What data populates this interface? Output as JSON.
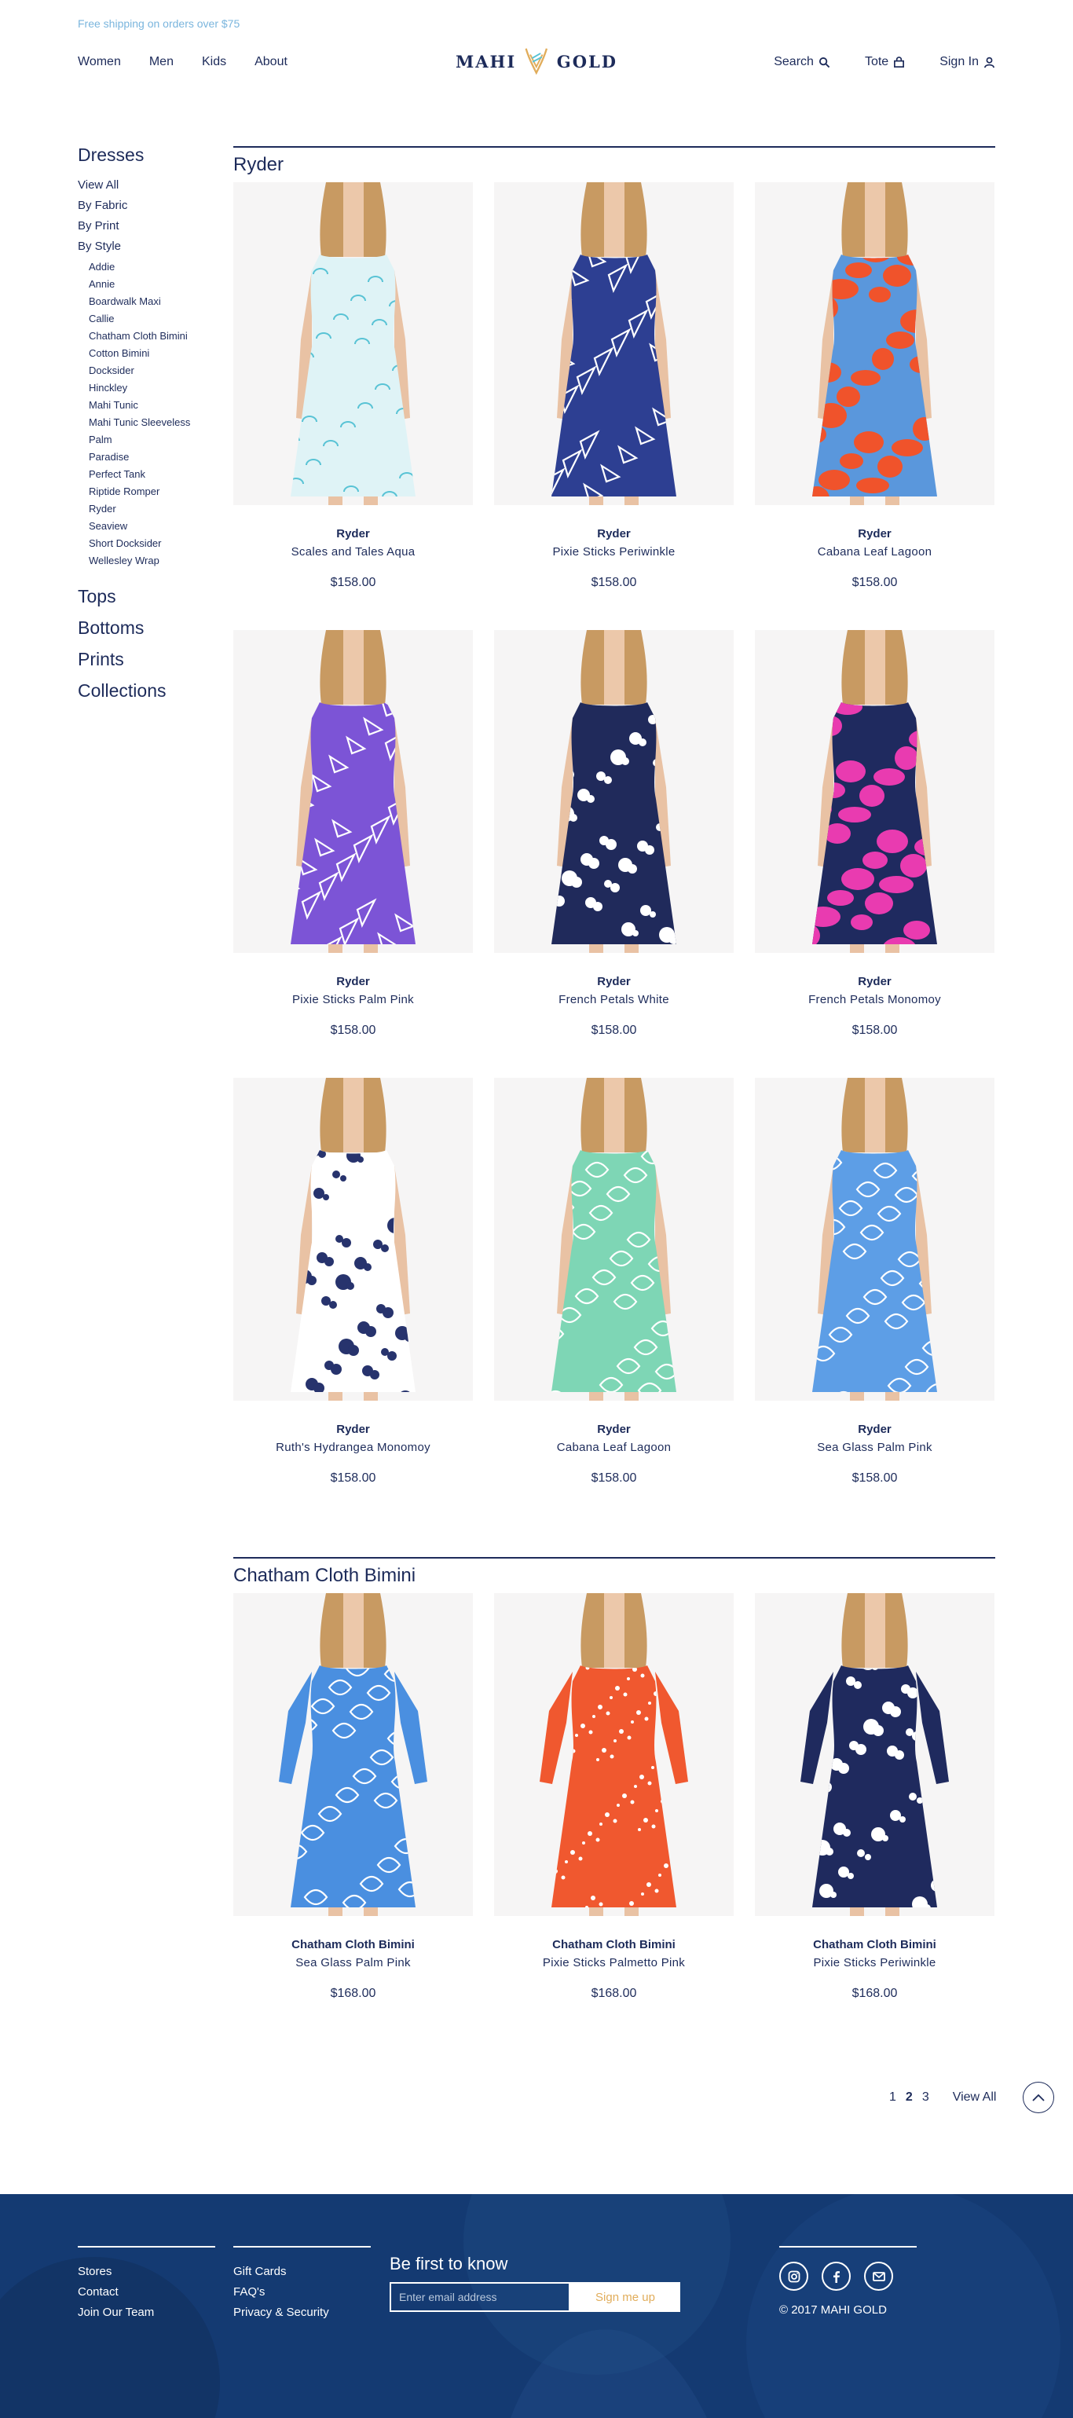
{
  "promo": "Free shipping on orders over $75",
  "nav": {
    "left": [
      "Women",
      "Men",
      "Kids",
      "About"
    ],
    "logo_left": "MAHI",
    "logo_right": "GOLD",
    "search": "Search",
    "tote": "Tote",
    "sign_in": "Sign In"
  },
  "sidebar": {
    "heading": "Dresses",
    "links": [
      "View All",
      "By Fabric",
      "By Print",
      "By Style"
    ],
    "styles": [
      "Addie",
      "Annie",
      "Boardwalk Maxi",
      "Callie",
      "Chatham Cloth Bimini",
      "Cotton Bimini",
      "Docksider",
      "Hinckley",
      "Mahi Tunic",
      "Mahi Tunic Sleeveless",
      "Palm",
      "Paradise",
      "Perfect Tank",
      "Riptide Romper",
      "Ryder",
      "Seaview",
      "Short Docksider",
      "Wellesley Wrap"
    ],
    "categories": [
      "Tops",
      "Bottoms",
      "Prints",
      "Collections"
    ]
  },
  "sections": [
    {
      "title": "Ryder",
      "products": [
        {
          "brand": "Ryder",
          "name": "Scales and Tales Aqua",
          "price": "$158.00",
          "dress": "#dff3f6",
          "print": "#59c3d5",
          "pattern": "scales",
          "sleeves": false
        },
        {
          "brand": "Ryder",
          "name": "Pixie Sticks Periwinkle",
          "price": "$158.00",
          "dress": "#2d3f92",
          "print": "#ffffff",
          "pattern": "sticks",
          "sleeves": false
        },
        {
          "brand": "Ryder",
          "name": "Cabana Leaf Lagoon",
          "price": "$158.00",
          "dress": "#5a97dc",
          "print": "#f0532b",
          "pattern": "blobs",
          "sleeves": false
        },
        {
          "brand": "Ryder",
          "name": "Pixie Sticks Palm Pink",
          "price": "$158.00",
          "dress": "#7c54d6",
          "print": "#ffffff",
          "pattern": "sticks",
          "sleeves": false
        },
        {
          "brand": "Ryder",
          "name": "French Petals White",
          "price": "$158.00",
          "dress": "#202a5b",
          "print": "#ffffff",
          "pattern": "petals",
          "sleeves": false
        },
        {
          "brand": "Ryder",
          "name": "French Petals Monomoy",
          "price": "$158.00",
          "dress": "#1f2a5f",
          "print": "#e93bb0",
          "pattern": "blobs",
          "sleeves": false
        },
        {
          "brand": "Ryder",
          "name": "Ruth's Hydrangea Monomoy",
          "price": "$158.00",
          "dress": "#ffffff",
          "print": "#27336d",
          "pattern": "petals",
          "sleeves": false
        },
        {
          "brand": "Ryder",
          "name": "Cabana Leaf Lagoon",
          "price": "$158.00",
          "dress": "#7ed6b5",
          "print": "#ffffff",
          "pattern": "leaves",
          "sleeves": false
        },
        {
          "brand": "Ryder",
          "name": "Sea Glass Palm Pink",
          "price": "$158.00",
          "dress": "#5d9ee6",
          "print": "#ffffff",
          "pattern": "leaves",
          "sleeves": false
        }
      ]
    },
    {
      "title": "Chatham Cloth Bimini",
      "products": [
        {
          "brand": "Chatham Cloth Bimini",
          "name": "Sea Glass Palm Pink",
          "price": "$168.00",
          "dress": "#4a8fe0",
          "print": "#ffffff",
          "pattern": "leaves",
          "sleeves": true
        },
        {
          "brand": "Chatham Cloth Bimini",
          "name": "Pixie Sticks Palmetto Pink",
          "price": "$168.00",
          "dress": "#f0582f",
          "print": "#ffffff",
          "pattern": "dots",
          "sleeves": true
        },
        {
          "brand": "Chatham Cloth Bimini",
          "name": "Pixie Sticks Periwinkle",
          "price": "$168.00",
          "dress": "#1f2a5e",
          "print": "#ffffff",
          "pattern": "petals",
          "sleeves": true
        }
      ]
    }
  ],
  "pagination": {
    "pages": [
      "1",
      "2",
      "3"
    ],
    "current": "2",
    "view_all": "View All"
  },
  "footer": {
    "col1": [
      "Stores",
      "Contact",
      "Join Our Team"
    ],
    "col2": [
      "Gift Cards",
      "FAQ's",
      "Privacy & Security"
    ],
    "signup_title": "Be first to know",
    "email_placeholder": "Enter email address",
    "signup_button": "Sign me up",
    "social_icons": [
      "instagram-icon",
      "facebook-icon",
      "email-icon"
    ],
    "copyright": "© 2017 MAHI GOLD"
  },
  "colors": {
    "navy": "#1d2b5a",
    "footer_bg": "#143a72",
    "promo": "#7ab5dd",
    "accent_gold": "#e1ad5b"
  }
}
